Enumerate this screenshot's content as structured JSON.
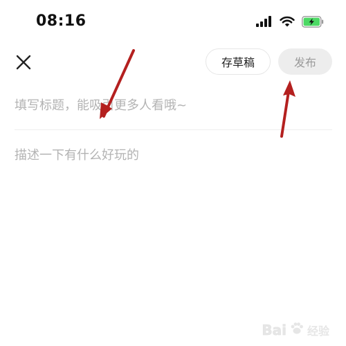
{
  "status_bar": {
    "time": "08:16",
    "icons": [
      "signal-icon",
      "wifi-icon",
      "battery-charging-icon"
    ],
    "battery_color": "#4cd964"
  },
  "toolbar": {
    "close_icon": "close-icon",
    "draft_label": "存草稿",
    "publish_label": "发布",
    "publish_enabled": false
  },
  "editor": {
    "title_placeholder": "填写标题，能吸引更多人看哦~",
    "title_value": "",
    "body_placeholder": "描述一下有什么好玩的",
    "body_value": ""
  },
  "annotations": {
    "arrow_color": "#b4201f",
    "count": 2
  },
  "watermark": {
    "brand_text": "Bai",
    "sub_text": "经验"
  }
}
